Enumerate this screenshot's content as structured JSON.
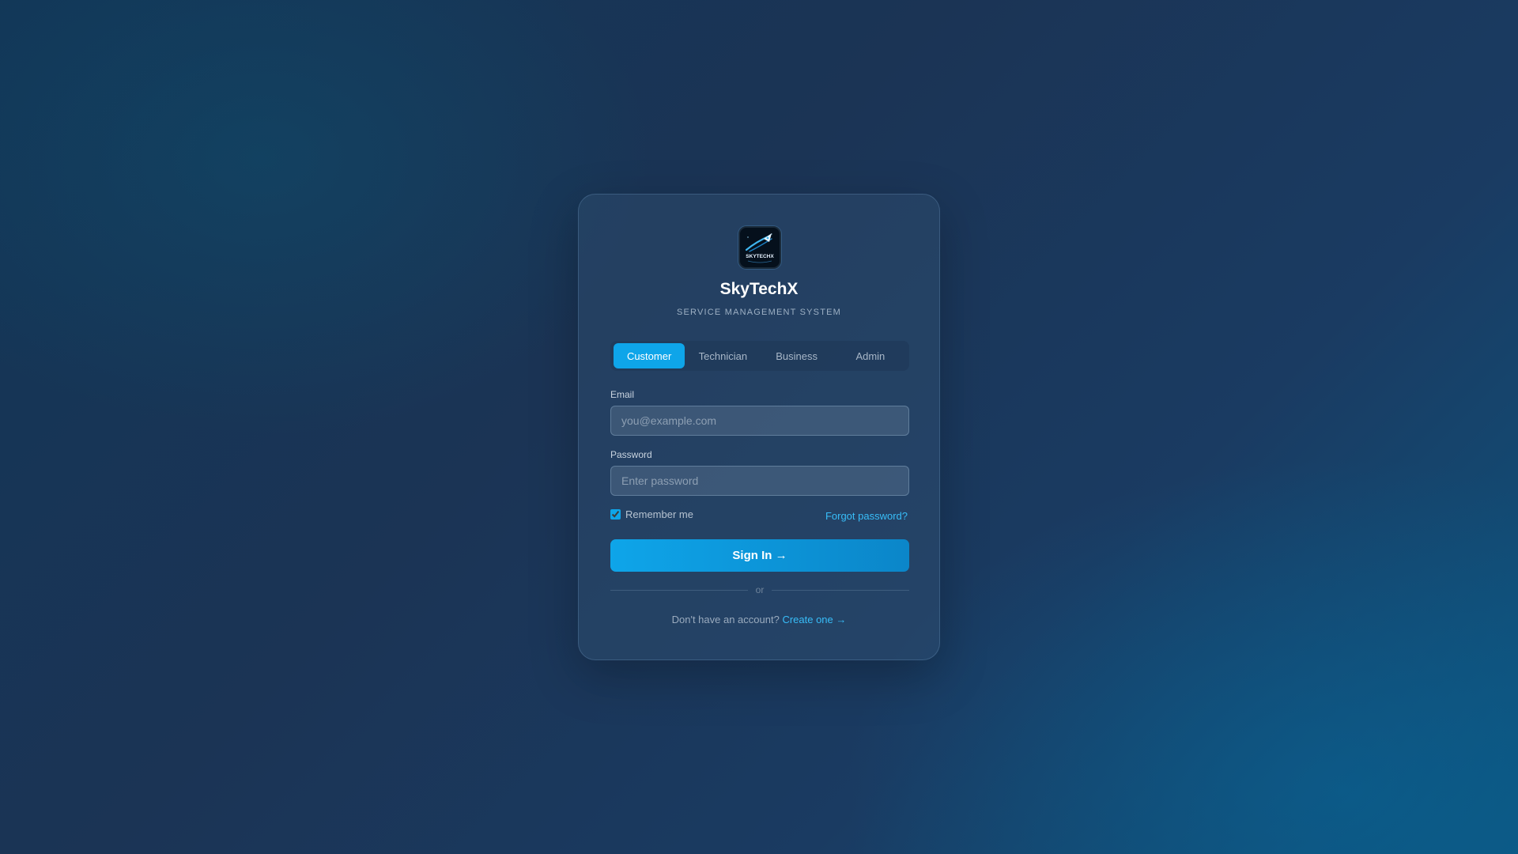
{
  "app": {
    "name": "SkyTechX",
    "tagline": "SERVICE MANAGEMENT SYSTEM",
    "logo_text": "SKYTECHX"
  },
  "tabs": [
    {
      "label": "Customer",
      "active": true
    },
    {
      "label": "Technician",
      "active": false
    },
    {
      "label": "Business",
      "active": false
    },
    {
      "label": "Admin",
      "active": false
    }
  ],
  "form": {
    "email_label": "Email",
    "email_placeholder": "you@example.com",
    "email_value": "",
    "password_label": "Password",
    "password_placeholder": "Enter password",
    "password_value": "",
    "remember_label": "Remember me",
    "remember_checked": true,
    "forgot_label": "Forgot password?",
    "signin_label": "Sign In →",
    "divider_label": "or",
    "signup_prompt": "Don't have an account?",
    "signup_link": "Create one →"
  },
  "colors": {
    "accent": "#0ea5e9",
    "link": "#38bdf8",
    "background_dark": "#1b3455",
    "background_light": "#0d5680"
  },
  "icons": {
    "logo": "rocket-logo-icon"
  }
}
